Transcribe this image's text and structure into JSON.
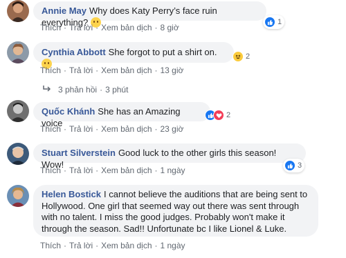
{
  "comments": [
    {
      "author": "Annie May",
      "text": "Why does Katy Perry’s face ruin everything?",
      "actions": {
        "like": "Thích",
        "reply": "Trả lời",
        "translate": "Xem bản dịch",
        "time": "8 giờ"
      },
      "reactions": {
        "types": [
          "like"
        ],
        "count": "1"
      }
    },
    {
      "author": "Cynthia Abbott",
      "text": "She forgot to put a shirt on.",
      "actions": {
        "like": "Thích",
        "reply": "Trả lời",
        "translate": "Xem bản dịch",
        "time": "13 giờ"
      },
      "reactions": {
        "types": [
          "haha"
        ],
        "count": "2"
      },
      "replies": {
        "count_label": "3 phản hồi",
        "time": "3 phút"
      }
    },
    {
      "author": "Quốc Khánh",
      "text": "She has an Amazing voice",
      "actions": {
        "like": "Thích",
        "reply": "Trả lời",
        "translate": "Xem bản dịch",
        "time": "23 giờ"
      },
      "reactions": {
        "types": [
          "like",
          "love"
        ],
        "count": "2"
      }
    },
    {
      "author": "Stuart Silverstein",
      "text": "Good luck to the other girls this season! Wow!",
      "actions": {
        "like": "Thích",
        "reply": "Trả lời",
        "translate": "Xem bản dịch",
        "time": "1 ngày"
      },
      "reactions": {
        "types": [
          "like"
        ],
        "count": "3"
      }
    },
    {
      "author": "Helen Bostick",
      "text": "I cannot believe the auditions that are being sent to Hollywood. One girl that seemed way out there was sent through with no talent. I miss the good judges. Probably won't make it through the season. Sad!! Unfortunate bc I like Lionel & Luke.",
      "actions": {
        "like": "Thích",
        "reply": "Trả lời",
        "translate": "Xem bản dịch",
        "time": "1 ngày"
      }
    }
  ],
  "colors": {
    "author_blue": "#385898",
    "bubble_bg": "#f2f3f5",
    "meta_gray": "#606770",
    "like_blue": "#1877f2",
    "love_red": "#f33e58"
  }
}
